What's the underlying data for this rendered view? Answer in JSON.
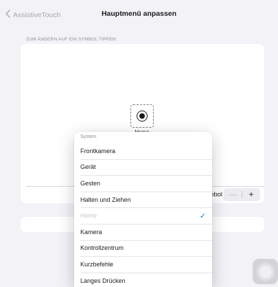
{
  "nav": {
    "back_label": "AssistiveTouch",
    "title": "Hauptmenü anpassen"
  },
  "customize": {
    "caption": "ZUM ÄNDERN AUF EIN SYMBOL TIPPEN:",
    "slot_icon": "home-button-icon",
    "slot_label": "Home",
    "symbol_label": "mbol",
    "stepper_minus": "—",
    "stepper_plus": "+"
  },
  "menu": {
    "header": "System",
    "items": [
      {
        "label": "Frontkamera",
        "enabled": true,
        "checked": false
      },
      {
        "label": "Gerät",
        "enabled": true,
        "checked": false
      },
      {
        "label": "Gesten",
        "enabled": true,
        "checked": false
      },
      {
        "label": "Halten und Ziehen",
        "enabled": true,
        "checked": false
      },
      {
        "label": "Home",
        "enabled": false,
        "checked": true
      },
      {
        "label": "Kamera",
        "enabled": true,
        "checked": false
      },
      {
        "label": "Kontrollzentrum",
        "enabled": true,
        "checked": false
      },
      {
        "label": "Kurzbefehle",
        "enabled": true,
        "checked": false
      },
      {
        "label": "Langes Drücken",
        "enabled": true,
        "checked": false
      }
    ],
    "check_mark": "✓"
  },
  "colors": {
    "accent": "#0a7aff",
    "background": "#f2f2f7",
    "card": "#ffffff",
    "disabled_text": "#c7c7cc"
  }
}
